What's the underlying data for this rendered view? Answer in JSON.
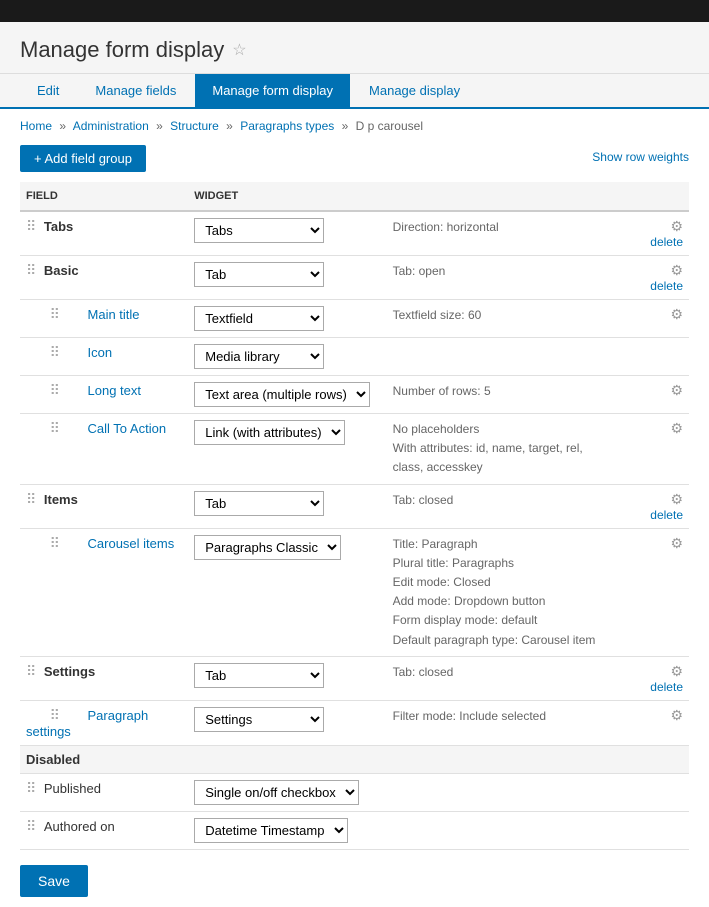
{
  "topbar": {},
  "header": {
    "title": "Manage form display",
    "star_label": "☆"
  },
  "tabs": [
    {
      "label": "Edit",
      "active": false
    },
    {
      "label": "Manage fields",
      "active": false
    },
    {
      "label": "Manage form display",
      "active": true
    },
    {
      "label": "Manage display",
      "active": false
    }
  ],
  "breadcrumb": {
    "items": [
      "Home",
      "Administration",
      "Structure",
      "Paragraphs types",
      "D p carousel"
    ]
  },
  "toolbar": {
    "add_field_group": "Add field group",
    "show_row_weights": "Show row weights"
  },
  "table": {
    "headers": [
      "FIELD",
      "WIDGET"
    ],
    "rows": [
      {
        "type": "field",
        "indent": 0,
        "name": "Tabs",
        "widget": "Tabs",
        "info": "Direction: horizontal",
        "has_gear": true,
        "has_delete": true
      },
      {
        "type": "field",
        "indent": 0,
        "name": "Basic",
        "widget": "Tab",
        "info": "Tab: open",
        "has_gear": true,
        "has_delete": true
      },
      {
        "type": "field",
        "indent": 1,
        "name": "Main title",
        "widget": "Textfield",
        "info": "Textfield size: 60",
        "has_gear": true,
        "has_delete": false
      },
      {
        "type": "field",
        "indent": 1,
        "name": "Icon",
        "widget": "Media library",
        "info": "",
        "has_gear": false,
        "has_delete": false
      },
      {
        "type": "field",
        "indent": 1,
        "name": "Long text",
        "widget": "Text area (multiple rows)",
        "info": "Number of rows: 5",
        "has_gear": true,
        "has_delete": false
      },
      {
        "type": "field",
        "indent": 1,
        "name": "Call To Action",
        "widget": "Link (with attributes)",
        "info": "No placeholders\nWith attributes: id, name, target, rel, class, accesskey",
        "has_gear": true,
        "has_delete": false
      },
      {
        "type": "field",
        "indent": 0,
        "name": "Items",
        "widget": "Tab",
        "info": "Tab: closed",
        "has_gear": true,
        "has_delete": true
      },
      {
        "type": "field",
        "indent": 1,
        "name": "Carousel items",
        "widget": "Paragraphs Classic",
        "info": "Title: Paragraph\nPlural title: Paragraphs\nEdit mode: Closed\nAdd mode: Dropdown button\nForm display mode: default\nDefault paragraph type: Carousel item",
        "has_gear": true,
        "has_delete": false
      },
      {
        "type": "field",
        "indent": 0,
        "name": "Settings",
        "widget": "Tab",
        "info": "Tab: closed",
        "has_gear": true,
        "has_delete": true
      },
      {
        "type": "field",
        "indent": 1,
        "name": "Paragraph\nsettings",
        "widget": "Settings",
        "info": "Filter mode: Include selected",
        "has_gear": true,
        "has_delete": false
      }
    ],
    "disabled_rows": [
      {
        "name": "Published",
        "widget": "Single on/off checkbox"
      },
      {
        "name": "Authored on",
        "widget": "Datetime Timestamp"
      }
    ],
    "disabled_label": "Disabled"
  },
  "save": "Save"
}
